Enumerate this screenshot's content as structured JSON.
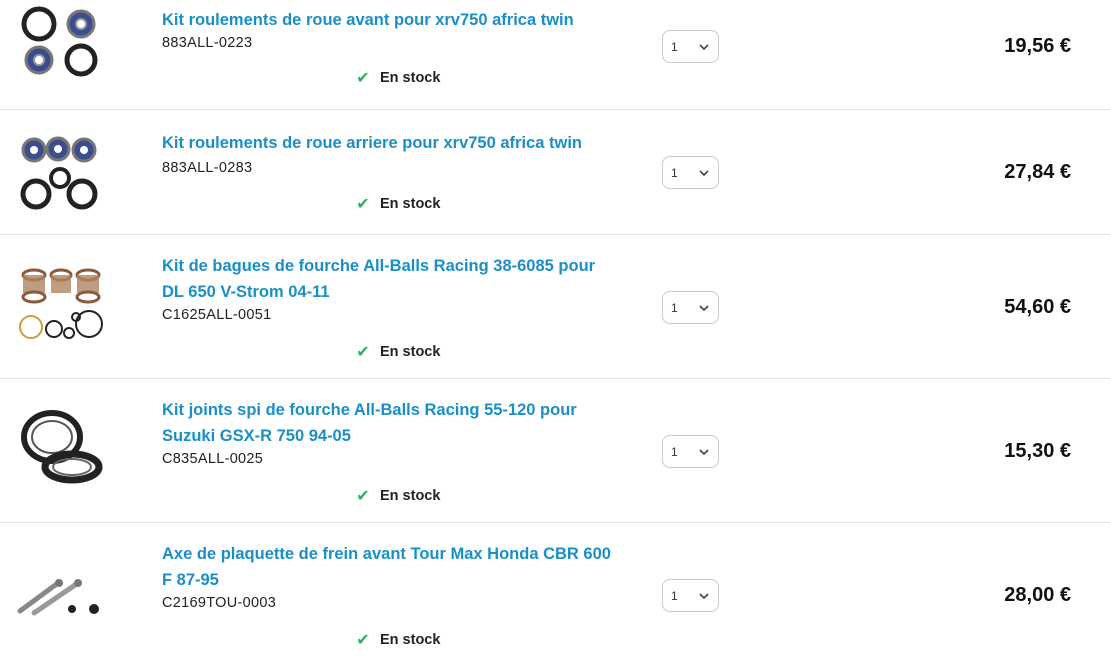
{
  "colors": {
    "title_blue": "#1a8fc7",
    "stock_green": "#2fae60",
    "divider": "#e3e3e3"
  },
  "products": [
    {
      "title": "Kit roulements de roue avant pour xrv750 africa twin",
      "ref": "883ALL-0223",
      "stock": "En stock",
      "qty": "1",
      "price": "19,56 €",
      "image_icon": "wheel-bearing-kit-icon"
    },
    {
      "title": "Kit roulements de roue arriere pour xrv750 africa twin",
      "ref": "883ALL-0283",
      "stock": "En stock",
      "qty": "1",
      "price": "27,84 €",
      "image_icon": "wheel-bearing-kit-icon"
    },
    {
      "title_line1": "Kit de bagues de fourche All-Balls Racing 38-6085 pour",
      "title_line2": "DL 650 V-Strom 04-11",
      "ref": "C1625ALL-0051",
      "stock": "En stock",
      "qty": "1",
      "price": "54,60 €",
      "image_icon": "fork-bushing-kit-icon"
    },
    {
      "title_line1": "Kit joints spi de fourche All-Balls Racing 55-120 pour",
      "title_line2": "Suzuki GSX-R 750 94-05",
      "ref": "C835ALL-0025",
      "stock": "En stock",
      "qty": "1",
      "price": "15,30 €",
      "image_icon": "fork-seal-kit-icon"
    },
    {
      "title_line1": "Axe de plaquette de frein avant Tour Max Honda CBR 600",
      "title_line2": "F 87-95",
      "ref": "C2169TOU-0003",
      "stock": "En stock",
      "qty": "1",
      "price": "28,00 €",
      "image_icon": "brake-pad-pin-icon"
    }
  ]
}
